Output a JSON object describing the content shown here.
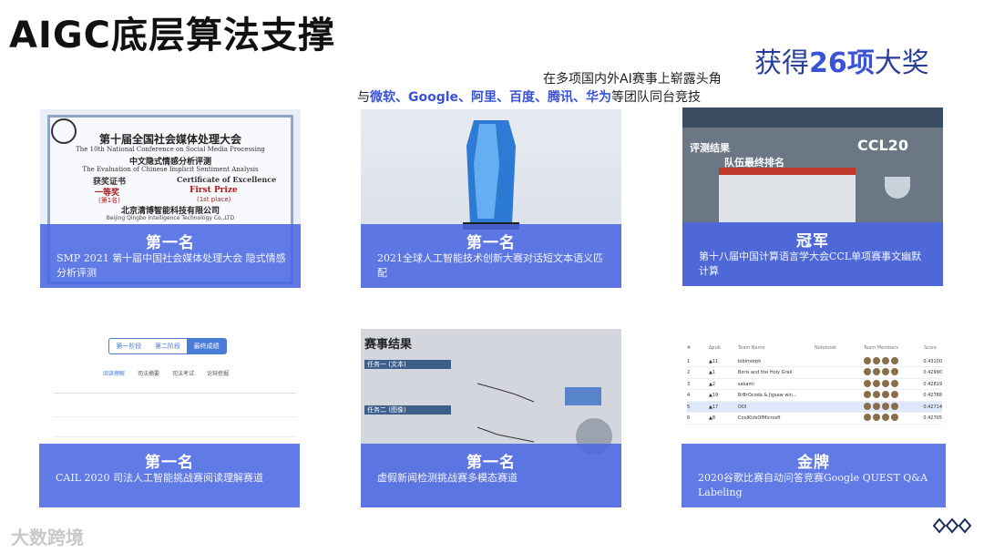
{
  "title": "AIGC底层算法支撑",
  "award": {
    "prefix": "获得",
    "count": "26项",
    "suffix": "大奖"
  },
  "subtitle_line1": "在多项国内外AI赛事上崭露头角",
  "subtitle_line2": {
    "prefix": "与",
    "companies": "微软、Google、阿里、百度、腾讯、华为",
    "suffix": "等团队同台竞技"
  },
  "cards": [
    {
      "rank": "第一名",
      "desc": "SMP 2021 第十届中国社会媒体处理大会 隐式情感分析评测",
      "cert": {
        "title": "第十届全国社会媒体处理大会",
        "title_en": "The 10th National Conference on Social Media Processing",
        "sub": "中文隐式情感分析评测",
        "sub_en": "The Evaluation of Chinese Implicit Sentiment Analysis",
        "cert_cn": "获奖证书",
        "cert_en": "Certificate of Excellence",
        "prize_cn": "一等奖",
        "prize_en": "First Prize",
        "place_cn": "(第1名)",
        "place_en": "(1st place)",
        "org": "北京清博智能科技有限公司",
        "org_en": "Beijing Qingbo Intelligence Technology Co.,LTD"
      }
    },
    {
      "rank": "第一名",
      "desc": "2021全球人工智能技术创新大赛对话短文本语义匹配"
    },
    {
      "rank": "冠军",
      "desc": "第十八届中国计算语言学大会CCL单项赛事文幽默计算",
      "screen": {
        "title": "评测结果",
        "logo": "CCL20",
        "table_title": "队伍最终排名"
      }
    },
    {
      "rank": "第一名",
      "desc": "CAIL 2020 司法人工智能挑战赛阅读理解赛道",
      "tabs": [
        "第一阶段",
        "第二阶段",
        "最终成绩"
      ],
      "subtabs": [
        "阅读理解",
        "司法摘要",
        "司法考试",
        "论辩挖掘"
      ]
    },
    {
      "rank": "第一名",
      "desc": "虚假新闻检测挑战赛多模态赛道",
      "screen": {
        "title": "赛事结果",
        "task1": "任务一 (文本)",
        "task2": "任务二 (图像)"
      }
    },
    {
      "rank": "金牌",
      "desc": "2020谷歌比赛自动问答竞赛Google QUEST Q&A Labeling",
      "board": {
        "headers": [
          "#",
          "Δpub",
          "Team Name",
          "Notebook",
          "Team Members",
          "Score"
        ],
        "rows": [
          {
            "n": "1",
            "d": "▲11",
            "team": "bibimorph",
            "score": "0.43100"
          },
          {
            "n": "2",
            "d": "▲1",
            "team": "Boris and the Holy Grail",
            "score": "0.42990"
          },
          {
            "n": "3",
            "d": "▲2",
            "team": "sakami",
            "score": "0.42819"
          },
          {
            "n": "4",
            "d": "▲19",
            "team": "BrBrOcoda & Jigsaw win...",
            "score": "0.42788"
          },
          {
            "n": "5",
            "d": "▲17",
            "team": "OOI",
            "score": "0.42714"
          },
          {
            "n": "6",
            "d": "▲8",
            "team": "CoolKidsOfMicrosft",
            "score": "0.42705"
          }
        ]
      }
    }
  ],
  "footer_logo": "大数跨境",
  "colors": {
    "accent": "#3a53d6",
    "overlay": "#4a68e2"
  }
}
